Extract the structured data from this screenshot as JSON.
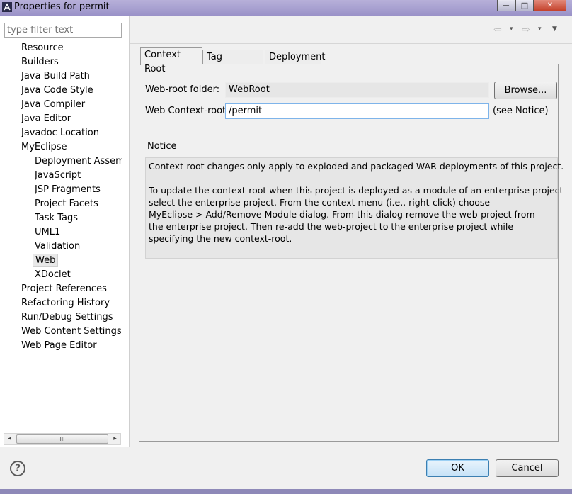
{
  "window": {
    "title": "Properties for permit",
    "controls": {
      "minimize": "—",
      "maximize": "□",
      "close": "✕"
    }
  },
  "filter": {
    "placeholder": "type filter text",
    "value": ""
  },
  "tree": {
    "items": [
      {
        "label": "Resource",
        "level": 1
      },
      {
        "label": "Builders",
        "level": 1
      },
      {
        "label": "Java Build Path",
        "level": 1
      },
      {
        "label": "Java Code Style",
        "level": 1
      },
      {
        "label": "Java Compiler",
        "level": 1
      },
      {
        "label": "Java Editor",
        "level": 1
      },
      {
        "label": "Javadoc Location",
        "level": 1
      },
      {
        "label": "MyEclipse",
        "level": 1
      },
      {
        "label": "Deployment Assembl",
        "level": 2
      },
      {
        "label": "JavaScript",
        "level": 2
      },
      {
        "label": "JSP Fragments",
        "level": 2
      },
      {
        "label": "Project Facets",
        "level": 2
      },
      {
        "label": "Task Tags",
        "level": 2
      },
      {
        "label": "UML1",
        "level": 2
      },
      {
        "label": "Validation",
        "level": 2
      },
      {
        "label": "Web",
        "level": 2,
        "selected": true
      },
      {
        "label": "XDoclet",
        "level": 2
      },
      {
        "label": "Project References",
        "level": 1
      },
      {
        "label": "Refactoring History",
        "level": 1
      },
      {
        "label": "Run/Debug Settings",
        "level": 1
      },
      {
        "label": "Web Content Settings",
        "level": 1
      },
      {
        "label": "Web Page Editor",
        "level": 1
      }
    ],
    "scroll_left_icon": "◂",
    "scroll_right_icon": "▸",
    "scroll_thumb_grip": "III"
  },
  "nav": {
    "back_icon": "⇦",
    "forward_icon": "⇨",
    "drop_icon": "▾",
    "menu_icon": "▼"
  },
  "tabs": [
    {
      "label": "Context Root",
      "active": true
    },
    {
      "label": "Tag Libraries",
      "active": false
    },
    {
      "label": "Deployment",
      "active": false
    }
  ],
  "form": {
    "webroot_label": "Web-root folder:",
    "webroot_value": "WebRoot",
    "browse_label": "Browse...",
    "context_label": "Web Context-root:",
    "context_value": "/permit",
    "see_notice": "(see Notice)"
  },
  "notice": {
    "heading": "Notice",
    "lines": [
      "Context-root changes only apply to exploded and packaged WAR deployments of this project.",
      "",
      "To update the context-root when this project is deployed as a module of an enterprise project",
      "select the enterprise project. From the context menu (i.e., right-click) choose",
      "MyEclipse > Add/Remove Module dialog. From this dialog remove the web-project from",
      "the enterprise project. Then re-add the web-project to the enterprise project while",
      "specifying the new context-root."
    ]
  },
  "footer": {
    "help_icon": "?",
    "ok_label": "OK",
    "cancel_label": "Cancel"
  },
  "colors": {
    "titlebar": "#9a92c8",
    "dialog_bg": "#f0f0f0",
    "focus_border": "#7eb4ea",
    "default_button": "#3c7fb1"
  }
}
